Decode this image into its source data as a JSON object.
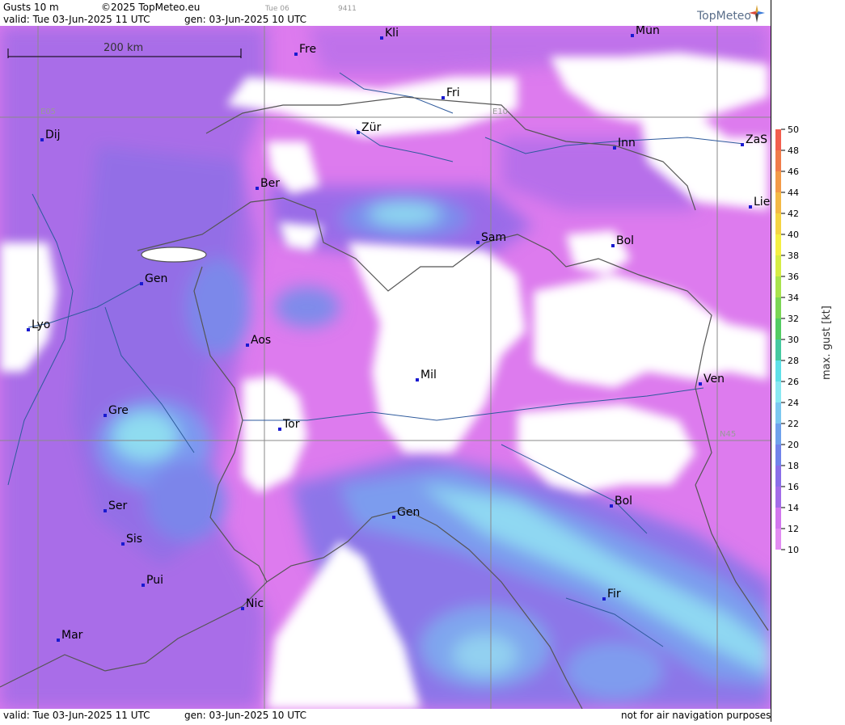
{
  "header": {
    "title": "Gusts 10 m",
    "copyright": "©2025 TopMeteo.eu",
    "day_tag": "Tue 06",
    "code": "9411",
    "valid": "valid:  Tue  03-Jun-2025  11 UTC",
    "gen": "gen: 03-Jun-2025 10 UTC",
    "logo": "TopMeteo"
  },
  "footer": {
    "valid": "valid:  Tue  03-Jun-2025  11 UTC",
    "gen": "gen: 03-Jun-2025 10 UTC",
    "disclaimer": "not for air navigation purposes"
  },
  "map": {
    "scale_label": "200 km",
    "grid_labels": {
      "e05": "E05",
      "e10": "E10",
      "n45": "N45"
    },
    "cities": [
      {
        "name": "Kli"
      },
      {
        "name": "Mün"
      },
      {
        "name": "Fre"
      },
      {
        "name": "Fri"
      },
      {
        "name": "Zür"
      },
      {
        "name": "Inn"
      },
      {
        "name": "ZaS"
      },
      {
        "name": "Dij"
      },
      {
        "name": "Ber"
      },
      {
        "name": "Lie"
      },
      {
        "name": "Sam"
      },
      {
        "name": "Bol"
      },
      {
        "name": "Gen"
      },
      {
        "name": "Lyo"
      },
      {
        "name": "Aos"
      },
      {
        "name": "Mil"
      },
      {
        "name": "Ven"
      },
      {
        "name": "Gre"
      },
      {
        "name": "Tor"
      },
      {
        "name": "Ser"
      },
      {
        "name": "Gen"
      },
      {
        "name": "Bol"
      },
      {
        "name": "Sis"
      },
      {
        "name": "Pui"
      },
      {
        "name": "Fir"
      },
      {
        "name": "Nic"
      },
      {
        "name": "Mar"
      }
    ]
  },
  "legend": {
    "title": "max. gust [kt]",
    "ticks": [
      "50",
      "48",
      "46",
      "44",
      "42",
      "40",
      "38",
      "36",
      "34",
      "32",
      "30",
      "28",
      "26",
      "24",
      "22",
      "20",
      "18",
      "16",
      "14",
      "12",
      "10"
    ],
    "colors": [
      "#f25f4e",
      "#f07c4a",
      "#f39a47",
      "#f4b945",
      "#f5d443",
      "#f5ef43",
      "#d6ec45",
      "#a9e34d",
      "#7bd655",
      "#53cc63",
      "#46c9a0",
      "#5fe0e8",
      "#8ae8f2",
      "#7cc8f0",
      "#6fa2ec",
      "#7183ea",
      "#8a6ee8",
      "#a36ce8",
      "#d277ee",
      "#e28cf2"
    ]
  }
}
